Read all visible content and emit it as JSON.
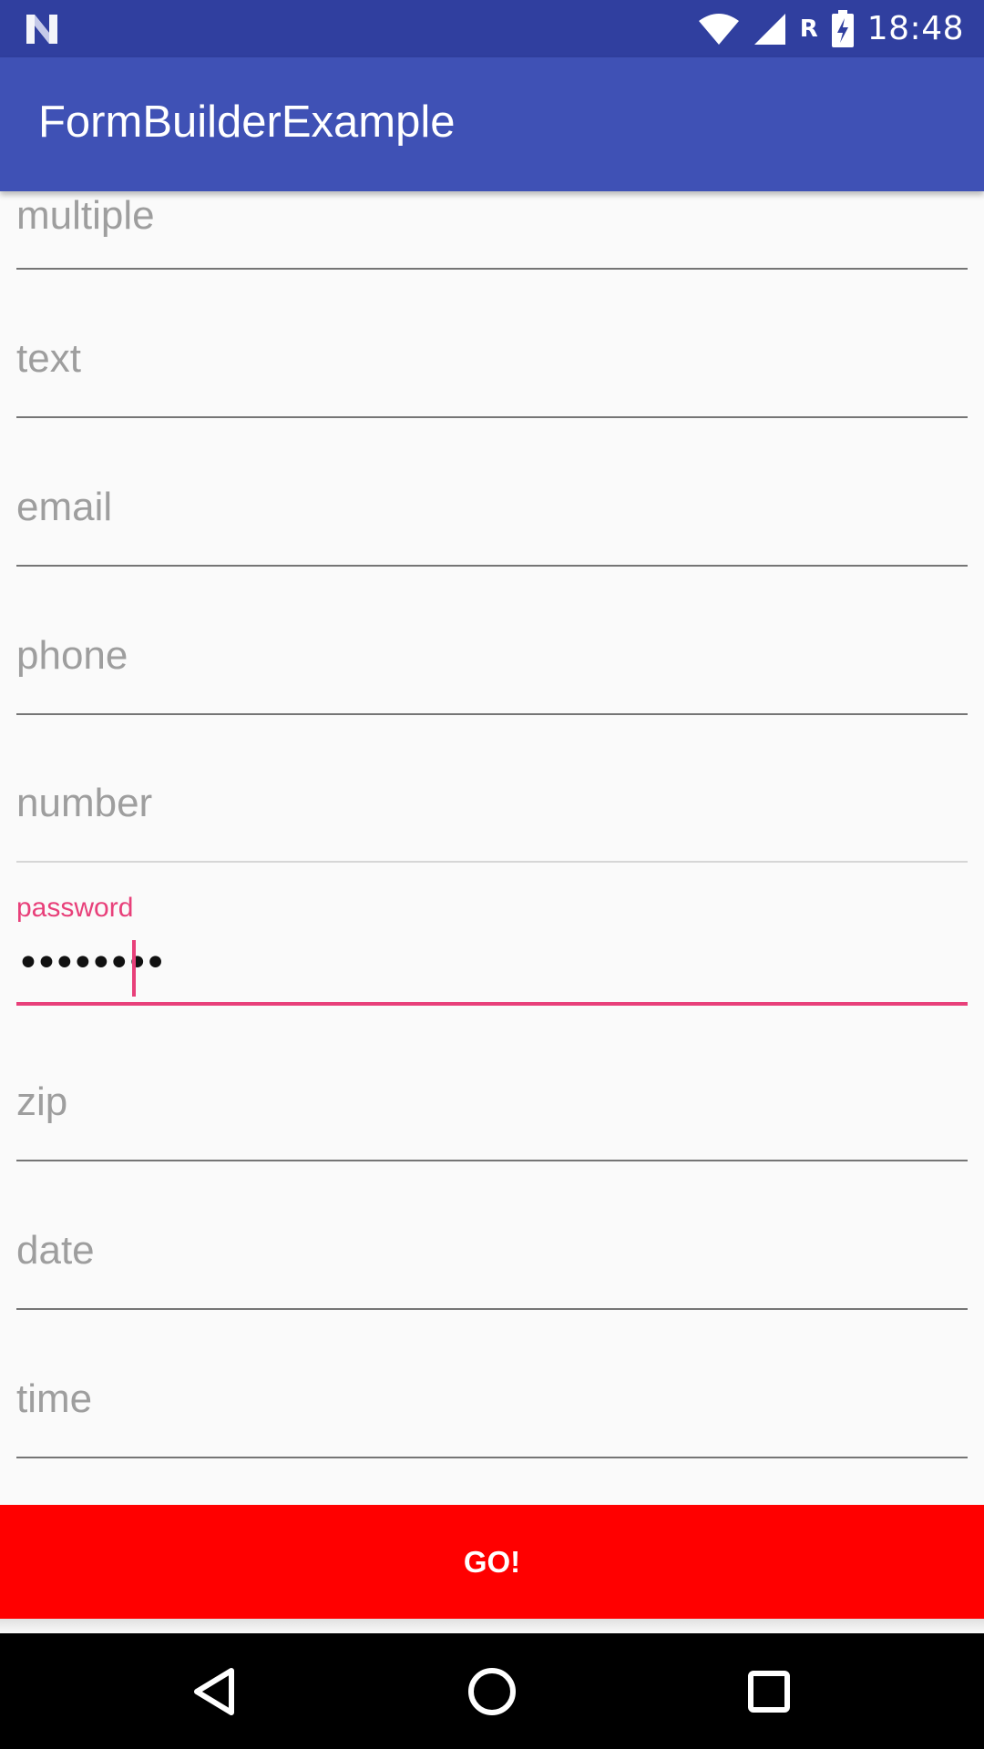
{
  "status_bar": {
    "clock": "18:48",
    "roaming_indicator": "R",
    "icons": [
      "notification-n-icon",
      "wifi-icon",
      "signal-icon",
      "battery-charging-icon"
    ]
  },
  "app_bar": {
    "title": "FormBuilderExample"
  },
  "form": {
    "fields": [
      {
        "name": "multiple",
        "hint": "multiple"
      },
      {
        "name": "text",
        "hint": "text"
      },
      {
        "name": "email",
        "hint": "email"
      },
      {
        "name": "phone",
        "hint": "phone"
      },
      {
        "name": "number",
        "hint": "number"
      },
      {
        "name": "password",
        "label": "password",
        "value": "••••••••",
        "focused": true
      },
      {
        "name": "zip",
        "hint": "zip"
      },
      {
        "name": "date",
        "hint": "date"
      },
      {
        "name": "time",
        "hint": "time"
      }
    ],
    "submit_label": "GO!"
  },
  "colors": {
    "status_bar": "#303f9f",
    "app_bar": "#3f51b5",
    "accent": "#e8407a",
    "button": "#ff0000"
  },
  "nav_bar": {
    "buttons": [
      "back-icon",
      "home-icon",
      "recents-icon"
    ]
  }
}
